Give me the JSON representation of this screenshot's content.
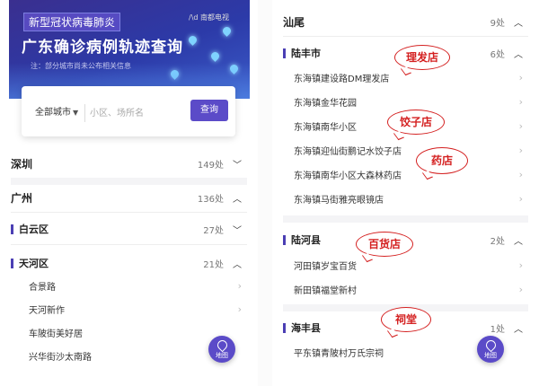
{
  "banner": {
    "tag": "新型冠状病毒肺炎",
    "title": "广东确诊病例轨迹查询",
    "note": "注：部分城市尚未公布相关信息",
    "logos": "/\\d 南都电视"
  },
  "search": {
    "city": "全部城市",
    "placeholder": "小区、场所名",
    "button": "查询"
  },
  "left": {
    "cities": [
      {
        "name": "深圳",
        "count": "149处",
        "expanded": false
      },
      {
        "name": "广州",
        "count": "136处",
        "expanded": true
      }
    ],
    "districts": [
      {
        "name": "白云区",
        "count": "27处",
        "expanded": false
      },
      {
        "name": "天河区",
        "count": "21处",
        "expanded": true
      }
    ],
    "locations": [
      "合景路",
      "天河新作",
      "车陂街美好居",
      "兴华街沙太南路"
    ]
  },
  "right": {
    "city": {
      "name": "汕尾",
      "count": "9处"
    },
    "districts": [
      {
        "name": "陆丰市",
        "count": "6处",
        "expanded": true,
        "locations": [
          "东海镇建设路DM理发店",
          "东海镇金华花园",
          "东海镇南华小区",
          "东海镇迎仙街鹏记水饺子店",
          "东海镇南华小区大森林药店",
          "东海镇马街雅亮眼镜店"
        ]
      },
      {
        "name": "陆河县",
        "count": "2处",
        "expanded": true,
        "locations": [
          "河田镇岁宝百货",
          "新田镇福堂新村"
        ]
      },
      {
        "name": "海丰县",
        "count": "1处",
        "expanded": true,
        "locations": [
          "平东镇青陂村万氏宗祠"
        ]
      }
    ]
  },
  "map_button": "地图",
  "annotations": [
    "理发店",
    "饺子店",
    "药店",
    "百货店",
    "祠堂"
  ],
  "colors": {
    "accent": "#5b4bc8",
    "annotation": "#d42020"
  }
}
